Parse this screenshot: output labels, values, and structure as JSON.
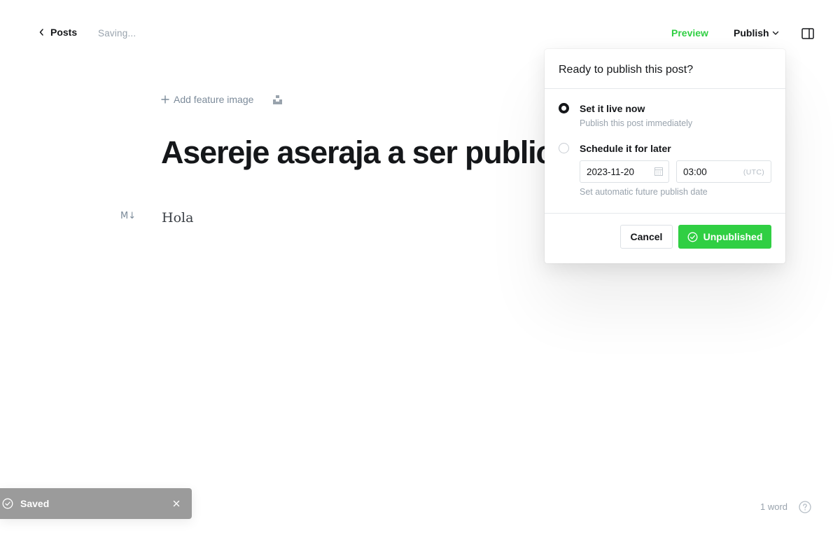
{
  "header": {
    "back_label": "Posts",
    "status_text": "Saving...",
    "preview_label": "Preview",
    "publish_label": "Publish",
    "icons": {
      "back": "chevron-left-icon",
      "publish_dropdown": "chevron-down-icon",
      "sidebar": "sidebar-toggle-icon"
    }
  },
  "editor": {
    "feature_image_label": "Add feature image",
    "title": "Asereje aseraja a ser publicado",
    "body": "Hola",
    "markdown_icon_text": "M↓"
  },
  "publish_menu": {
    "heading": "Ready to publish this post?",
    "options": [
      {
        "title": "Set it live now",
        "description": "Publish this post immediately",
        "selected": true
      },
      {
        "title": "Schedule it for later",
        "description": "Set automatic future publish date",
        "selected": false
      }
    ],
    "schedule": {
      "date": "2023-11-20",
      "time": "03:00",
      "timezone": "(UTC)"
    },
    "cancel_label": "Cancel",
    "confirm_label": "Unpublished"
  },
  "toast": {
    "message": "Saved"
  },
  "footer": {
    "word_count": "1 word"
  },
  "colors": {
    "accent_green": "#30cf43",
    "text_dark": "#15171a",
    "text_muted": "#99a3ad",
    "toast_bg": "#9b9b9b"
  }
}
